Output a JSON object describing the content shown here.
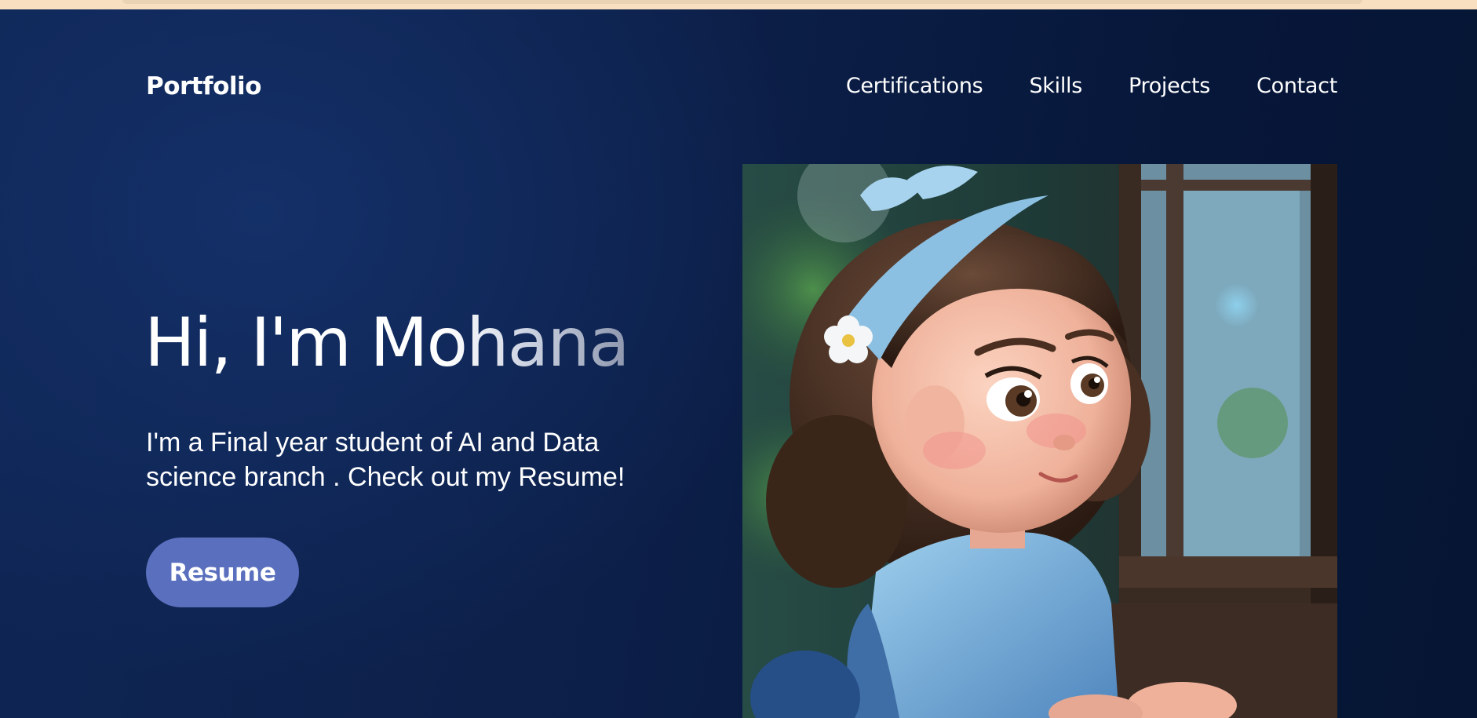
{
  "nav": {
    "logo": "Portfolio",
    "links": [
      "Certifications",
      "Skills",
      "Projects",
      "Contact"
    ]
  },
  "hero": {
    "heading": "Hi, I'm Mohana",
    "description": "I'm a Final year student of AI and Data science branch . Check out my Resume!",
    "resume_button": "Resume",
    "image_alt": "Illustrated girl with a blue headband sitting by a window"
  },
  "colors": {
    "background": "#0c1f48",
    "button": "#5a6fbe",
    "text": "#ffffff"
  }
}
